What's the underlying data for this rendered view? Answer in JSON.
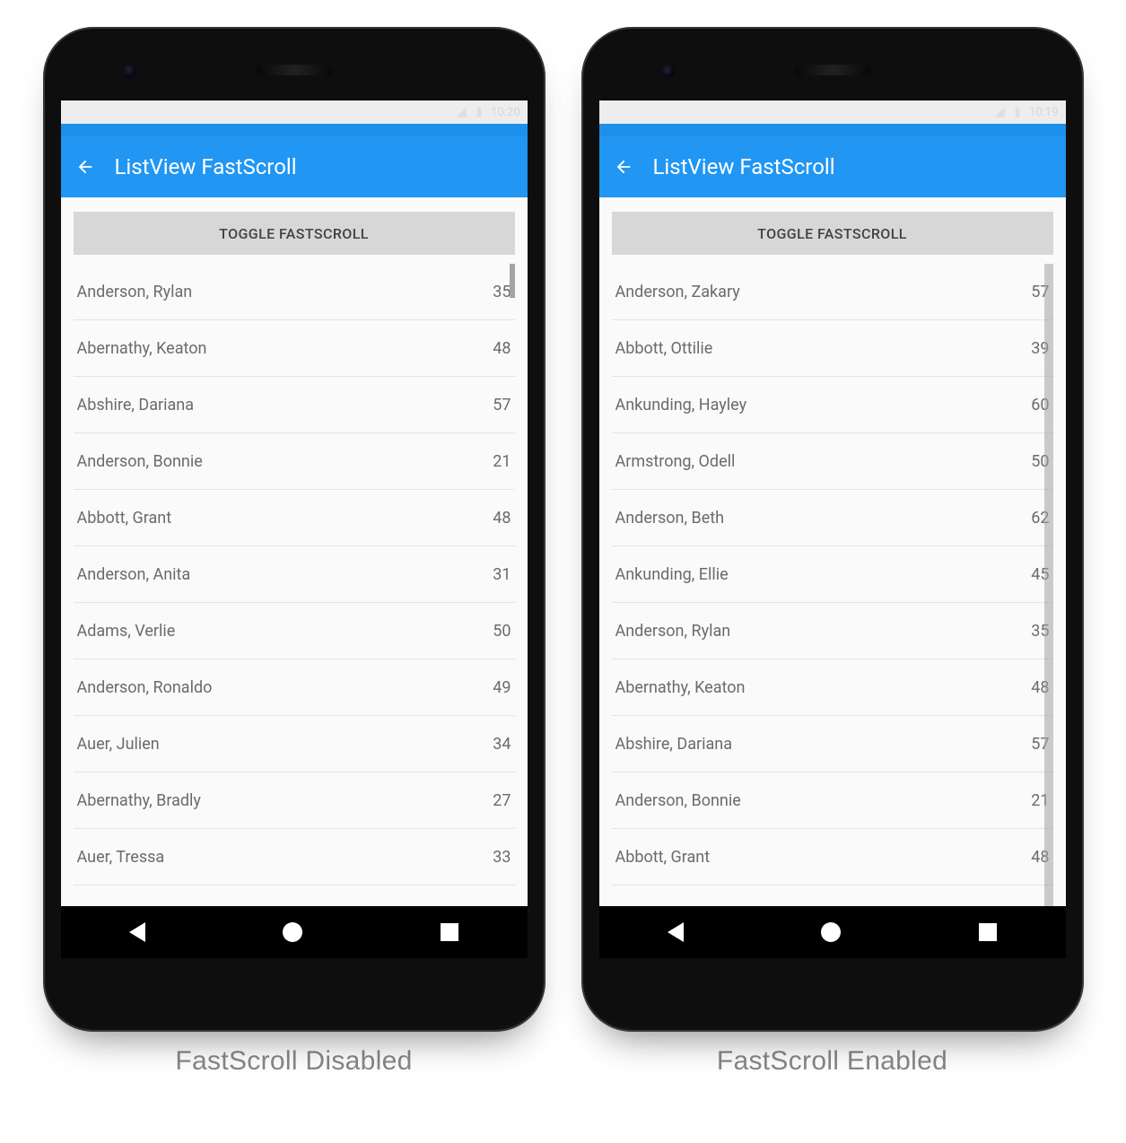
{
  "phones": [
    {
      "status_time": "10:20",
      "app_title": "ListView FastScroll",
      "button_label": "TOGGLE FASTSCROLL",
      "fastscroll": false,
      "caption": "FastScroll Disabled",
      "rows": [
        {
          "name": "Anderson, Rylan",
          "value": "35"
        },
        {
          "name": "Abernathy, Keaton",
          "value": "48"
        },
        {
          "name": "Abshire, Dariana",
          "value": "57"
        },
        {
          "name": "Anderson, Bonnie",
          "value": "21"
        },
        {
          "name": "Abbott, Grant",
          "value": "48"
        },
        {
          "name": "Anderson, Anita",
          "value": "31"
        },
        {
          "name": "Adams, Verlie",
          "value": "50"
        },
        {
          "name": "Anderson, Ronaldo",
          "value": "49"
        },
        {
          "name": "Auer, Julien",
          "value": "34"
        },
        {
          "name": "Abernathy, Bradly",
          "value": "27"
        },
        {
          "name": "Auer, Tressa",
          "value": "33"
        }
      ]
    },
    {
      "status_time": "10:19",
      "app_title": "ListView FastScroll",
      "button_label": "TOGGLE FASTSCROLL",
      "fastscroll": true,
      "caption": "FastScroll Enabled",
      "rows": [
        {
          "name": "Anderson, Zakary",
          "value": "57"
        },
        {
          "name": "Abbott, Ottilie",
          "value": "39"
        },
        {
          "name": "Ankunding, Hayley",
          "value": "60"
        },
        {
          "name": "Armstrong, Odell",
          "value": "50"
        },
        {
          "name": "Anderson, Beth",
          "value": "62"
        },
        {
          "name": "Ankunding, Ellie",
          "value": "45"
        },
        {
          "name": "Anderson, Rylan",
          "value": "35"
        },
        {
          "name": "Abernathy, Keaton",
          "value": "48"
        },
        {
          "name": "Abshire, Dariana",
          "value": "57"
        },
        {
          "name": "Anderson, Bonnie",
          "value": "21"
        },
        {
          "name": "Abbott, Grant",
          "value": "48"
        }
      ]
    }
  ]
}
